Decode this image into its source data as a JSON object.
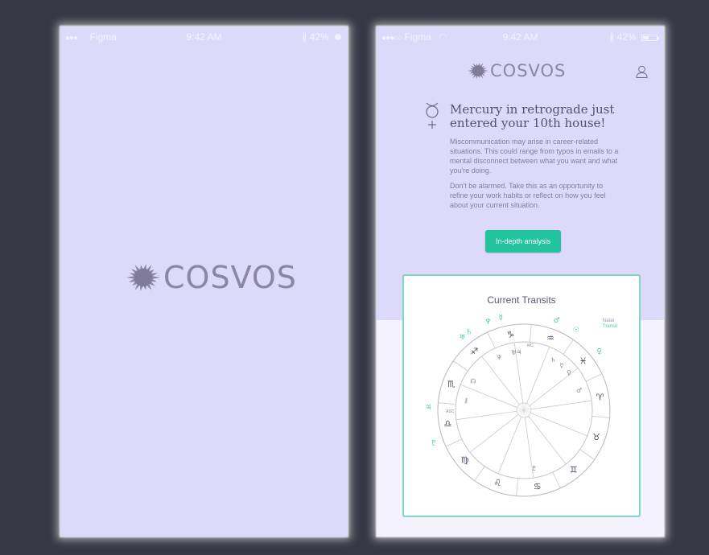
{
  "status_bar_left": {
    "carrier": "Figma",
    "time": "9:42 AM",
    "battery": "42%"
  },
  "status_bar_right": {
    "carrier": "Figma",
    "time": "9:42 AM",
    "battery": "42%"
  },
  "brand": {
    "name": "COSVOS"
  },
  "notification": {
    "headline": "Mercury in retrograde just entered your 10th house!",
    "paragraph1": "Miscommunication may arise in career-related situations. This could range from typos in emails to a mental disconnect between what you want and what you're doing.",
    "paragraph2": "Don't be alarmed. Take this as an opportunity to refine your work habits or reflect on how you feel about your current situation.",
    "planet_icon": "mercury-icon"
  },
  "cta": {
    "label": "In-depth analysis"
  },
  "transits": {
    "title": "Current Transits",
    "legend": {
      "natal": "Natal",
      "transit": "Transit"
    },
    "house_labels": {
      "asc": "ASC",
      "mc": "MC"
    },
    "signs": [
      "♈",
      "♓",
      "♒",
      "♑",
      "♐",
      "♏",
      "♎",
      "♍",
      "♌",
      "♋",
      "♊",
      "♉"
    ],
    "natal_planets": [
      "♅",
      "♆",
      "♃",
      "♄",
      "☿",
      "♀",
      "♂",
      "♇",
      "⚷",
      "☊"
    ],
    "transit_planets": [
      "♆",
      "☿",
      "♂",
      "☉",
      "♀",
      "♅",
      "♄",
      "♃",
      "♇"
    ]
  },
  "colors": {
    "screen_bg": "#dcd9fb",
    "accent": "#22c4a0",
    "card_border": "#7dd8c4",
    "logo": "#8a86a4",
    "text": "#55506e"
  }
}
